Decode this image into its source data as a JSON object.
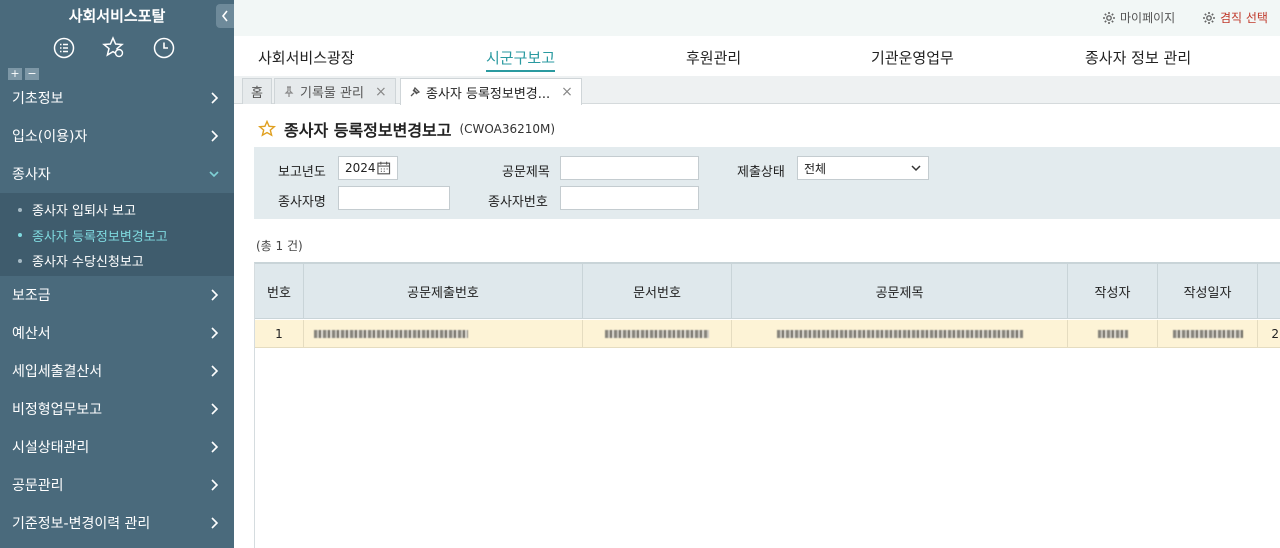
{
  "sidebar": {
    "title": "사회서비스포탈",
    "quick_icons": [
      "list-icon",
      "star-settings-icon",
      "clock-icon"
    ],
    "plus": "+",
    "minus": "−",
    "menu": [
      {
        "label": "기초정보"
      },
      {
        "label": "입소(이용)자"
      },
      {
        "label": "종사자"
      },
      {
        "label": "보조금"
      },
      {
        "label": "예산서"
      },
      {
        "label": "세입세출결산서"
      },
      {
        "label": "비정형업무보고"
      },
      {
        "label": "시설상태관리"
      },
      {
        "label": "공문관리"
      },
      {
        "label": "기준정보-변경이력 관리"
      }
    ],
    "submenu": [
      {
        "label": "종사자 입퇴사 보고"
      },
      {
        "label": "종사자 등록정보변경보고"
      },
      {
        "label": "종사자 수당신청보고"
      }
    ]
  },
  "topbar": {
    "mypage": "마이페이지",
    "job_select": "겸직 선택"
  },
  "mainnav": {
    "items": [
      "사회서비스광장",
      "시군구보고",
      "후원관리",
      "기관운영업무",
      "종사자 정보 관리"
    ],
    "active_index": 1
  },
  "tabs": {
    "home": "홈",
    "items": [
      {
        "label": "기록물 관리",
        "close": "×"
      },
      {
        "label": "종사자 등록정보변경...",
        "close": "×"
      }
    ]
  },
  "page": {
    "title": "종사자 등록정보변경보고",
    "code": "(CWOA36210M)"
  },
  "search": {
    "year_label": "보고년도",
    "year_value": "2024",
    "subject_label": "공문제목",
    "subject_value": "",
    "status_label": "제출상태",
    "status_value": "전체",
    "worker_name_label": "종사자명",
    "worker_name_value": "",
    "worker_no_label": "종사자번호",
    "worker_no_value": ""
  },
  "count_text": "(총 1 건)",
  "grid": {
    "columns": [
      "번호",
      "공문제출번호",
      "문서번호",
      "공문제목",
      "작성자",
      "작성일자"
    ],
    "rows": [
      {
        "no": "1",
        "extra": "2"
      }
    ]
  },
  "colors": {
    "sidebar_bg": "#4a6a7c",
    "accent": "#2a9aa0",
    "selected_row": "#fdf3d6"
  }
}
